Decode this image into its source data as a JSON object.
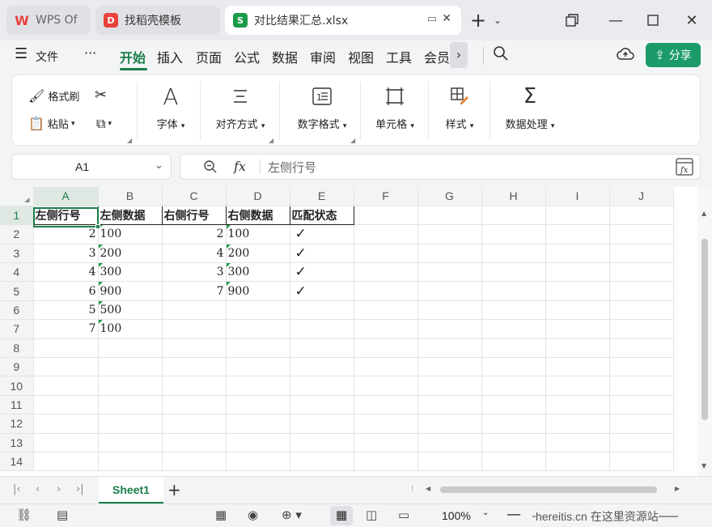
{
  "tabs": [
    {
      "label": "WPS Of",
      "icon": "W",
      "color": "#e8423b"
    },
    {
      "label": "找稻壳模板",
      "icon": "D",
      "color": "#e8423b"
    },
    {
      "label": "对比结果汇总.xlsx",
      "icon": "S",
      "color": "#1b9b4a"
    }
  ],
  "menu": {
    "file": "文件",
    "more": "···",
    "items": [
      "开始",
      "插入",
      "页面",
      "公式",
      "数据",
      "审阅",
      "视图",
      "工具",
      "会员"
    ],
    "share": "分享"
  },
  "ribbon": {
    "format_painter": "格式刷",
    "paste": "粘贴",
    "font": "字体",
    "align": "对齐方式",
    "number_format": "数字格式",
    "cell": "单元格",
    "style": "样式",
    "data_process": "数据处理"
  },
  "formula_bar": {
    "cell_ref": "A1",
    "fx": "fx",
    "content": "左侧行号"
  },
  "columns": [
    "A",
    "B",
    "C",
    "D",
    "E",
    "F",
    "G",
    "H",
    "I",
    "J"
  ],
  "rows": [
    [
      "左侧行号",
      "左侧数据",
      "右侧行号",
      "右侧数据",
      "匹配状态",
      "",
      "",
      "",
      "",
      ""
    ],
    [
      "2",
      "100",
      "2",
      "100",
      "✓",
      "",
      "",
      "",
      "",
      ""
    ],
    [
      "3",
      "200",
      "4",
      "200",
      "✓",
      "",
      "",
      "",
      "",
      ""
    ],
    [
      "4",
      "300",
      "3",
      "300",
      "✓",
      "",
      "",
      "",
      "",
      ""
    ],
    [
      "6",
      "900",
      "7",
      "900",
      "✓",
      "",
      "",
      "",
      "",
      ""
    ],
    [
      "5",
      "500",
      "",
      "",
      "",
      "",
      "",
      "",
      "",
      ""
    ],
    [
      "7",
      "100",
      "",
      "",
      "",
      "",
      "",
      "",
      "",
      ""
    ],
    [
      "",
      "",
      "",
      "",
      "",
      "",
      "",
      "",
      "",
      ""
    ],
    [
      "",
      "",
      "",
      "",
      "",
      "",
      "",
      "",
      "",
      ""
    ],
    [
      "",
      "",
      "",
      "",
      "",
      "",
      "",
      "",
      "",
      ""
    ],
    [
      "",
      "",
      "",
      "",
      "",
      "",
      "",
      "",
      "",
      ""
    ],
    [
      "",
      "",
      "",
      "",
      "",
      "",
      "",
      "",
      "",
      ""
    ],
    [
      "",
      "",
      "",
      "",
      "",
      "",
      "",
      "",
      "",
      ""
    ],
    [
      "",
      "",
      "",
      "",
      "",
      "",
      "",
      "",
      "",
      ""
    ]
  ],
  "sheet_tab": "Sheet1",
  "status": {
    "zoom": "100%",
    "watermark": "hereitis.cn 在这里资源站"
  },
  "accent": "#1b7f4a"
}
